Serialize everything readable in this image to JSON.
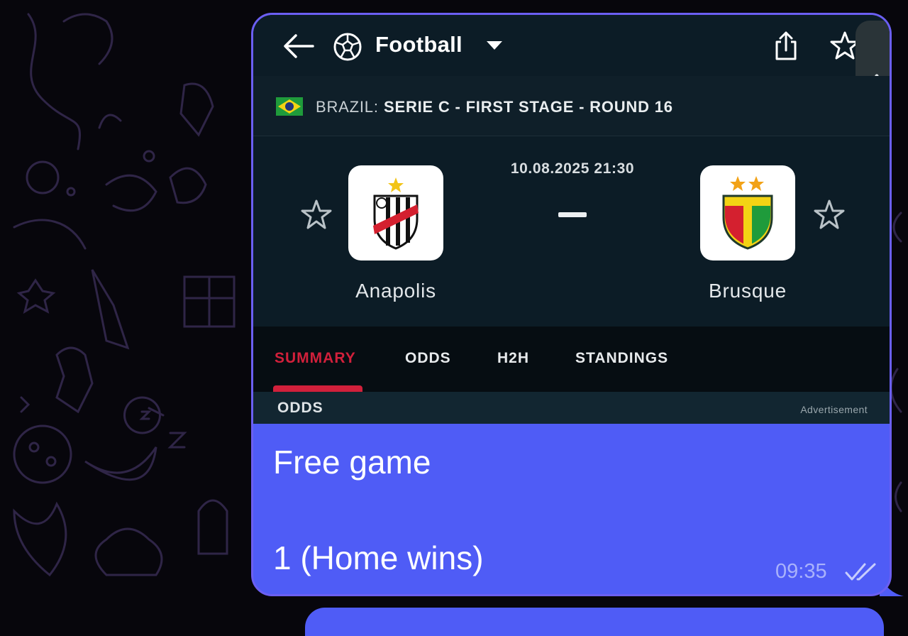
{
  "app": {
    "nav_title": "Football",
    "icons": [
      "back-arrow-icon",
      "soccer-ball-icon",
      "dropdown-caret-icon",
      "share-icon",
      "star-icon",
      "collapse-chevron-icon"
    ]
  },
  "league": {
    "country": "BRAZIL:",
    "name": "SERIE C - FIRST STAGE - ROUND 16",
    "flag": "brazil-flag-icon"
  },
  "match": {
    "datetime": "10.08.2025 21:30",
    "score": "-",
    "home": {
      "name": "Anapolis",
      "logo_text": "A.F.C."
    },
    "away": {
      "name": "Brusque",
      "logo_text": "BRUSQUE"
    }
  },
  "tabs": [
    {
      "label": "SUMMARY",
      "active": true
    },
    {
      "label": "ODDS",
      "active": false
    },
    {
      "label": "H2H",
      "active": false
    },
    {
      "label": "STANDINGS",
      "active": false
    }
  ],
  "odds_section": {
    "label": "ODDS",
    "ad_label": "Advertisement"
  },
  "message": {
    "line1": "Free game",
    "line2": "1 (Home wins)",
    "time": "09:35",
    "status_icon": "double-check-icon"
  },
  "colors": {
    "bubble": "#4f5cf6",
    "accent_red": "#d1203b",
    "app_dark": "#0c1c26"
  }
}
